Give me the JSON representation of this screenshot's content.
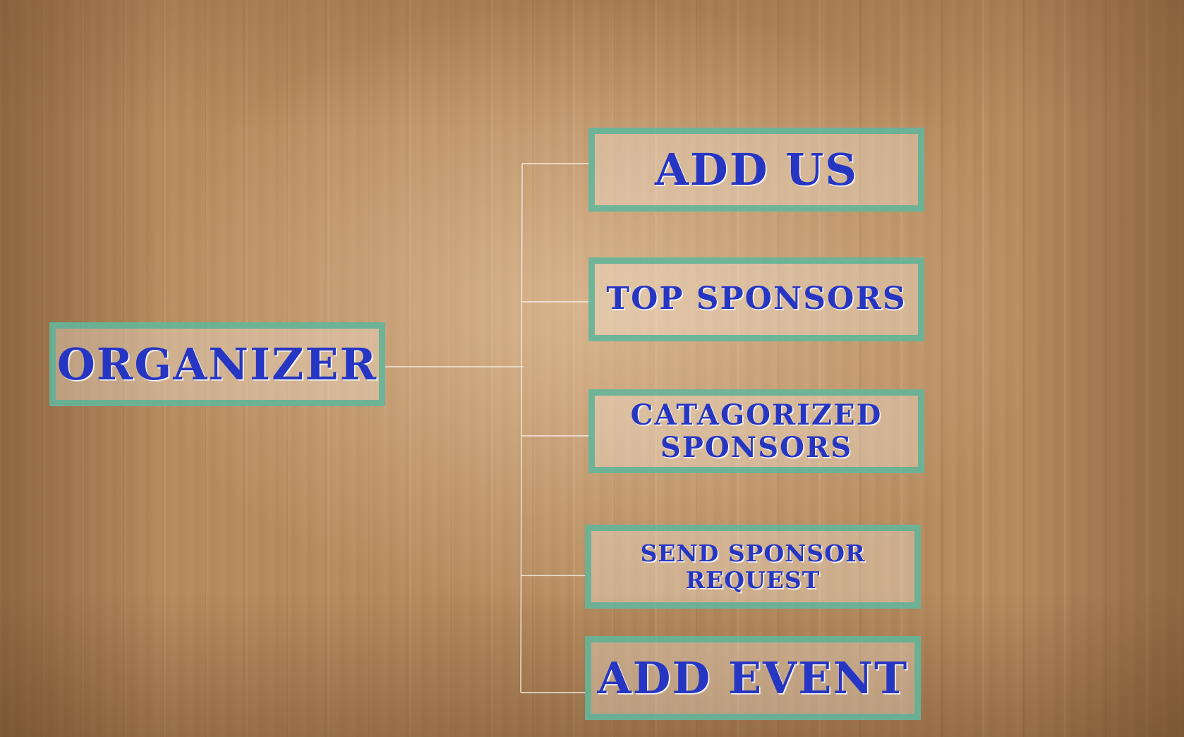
{
  "root": {
    "label": "ORGANIZER"
  },
  "menu": {
    "items": [
      {
        "label": "ADD US"
      },
      {
        "label": "TOP SPONSORS"
      },
      {
        "label": "CATAGORIZED\nSPONSORS"
      },
      {
        "label": "SEND SPONSOR REQUEST"
      },
      {
        "label": "ADD EVENT"
      }
    ]
  },
  "colors": {
    "text": "#2636c2",
    "box_border": "#5cb296",
    "connector": "#f2ebe2",
    "background": "#b58a5e"
  }
}
